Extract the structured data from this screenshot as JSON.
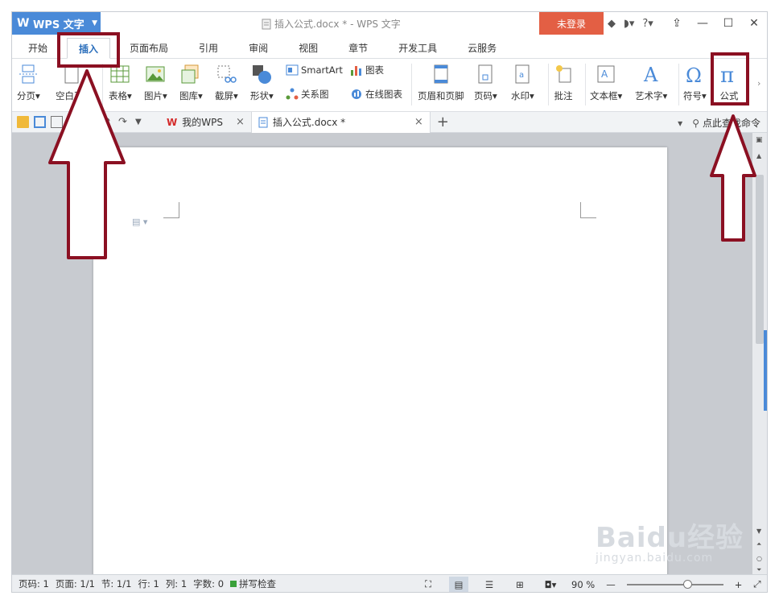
{
  "app": {
    "menu_label": "WPS 文字",
    "doc_title": "插入公式.docx * - WPS 文字",
    "login": "未登录",
    "help": "?"
  },
  "tabs": [
    "开始",
    "插入",
    "页面布局",
    "引用",
    "审阅",
    "视图",
    "章节",
    "开发工具",
    "云服务"
  ],
  "ribbon": {
    "page_break": "分页",
    "blank_page": "空白页",
    "table": "表格",
    "picture": "图片",
    "gallery": "图库",
    "screenshot": "截屏",
    "shape": "形状",
    "smartart": "SmartArt",
    "chart": "图表",
    "relation": "关系图",
    "online_chart": "在线图表",
    "header_footer": "页眉和页脚",
    "page_number": "页码",
    "watermark": "水印",
    "comment": "批注",
    "textbox": "文本框",
    "wordart": "艺术字",
    "symbol": "符号",
    "formula": "公式"
  },
  "doc_tabs": {
    "my_wps": "我的WPS",
    "current": "插入公式.docx *",
    "search_cmd": "点此查找命令"
  },
  "status": {
    "page_code": "页码: 1",
    "pages": "页面: 1/1",
    "section": "节: 1/1",
    "row": "行: 1",
    "col": "列: 1",
    "chars": "字数: 0",
    "spell": "拼写检查",
    "zoom": "90 %"
  },
  "watermark": {
    "brand": "Baidu经验",
    "url": "jingyan.baidu.com"
  },
  "colors": {
    "accent": "#4a8ad8",
    "login": "#e35f44",
    "annotation": "#8b1022"
  }
}
